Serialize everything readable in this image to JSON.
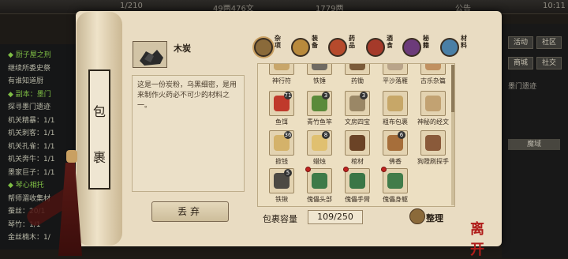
{
  "topbar": {
    "left_text": "1/210",
    "currency": "49两476文",
    "other": "1779两",
    "notice": "公告",
    "clock": "10:11"
  },
  "quest_panel": {
    "lines": [
      {
        "text": "◆ 厨子屋之刑",
        "head": true
      },
      {
        "text": "继续所委史祭",
        "head": false
      },
      {
        "text": "有谁知道厨",
        "head": false
      },
      {
        "text": "◆ 副本：墨门",
        "head": true
      },
      {
        "text": "探寻墨门遗迹",
        "head": false
      },
      {
        "text": "机关精暴：1/1",
        "head": false
      },
      {
        "text": "机关刺客：1/1",
        "head": false
      },
      {
        "text": "机关孔雀：1/1",
        "head": false
      },
      {
        "text": "机关奔牛：1/1",
        "head": false
      },
      {
        "text": "墨家巨子：1/1",
        "head": false
      },
      {
        "text": "◆ 琴心相托",
        "head": true
      },
      {
        "text": "帮师湄收集材",
        "head": false
      },
      {
        "text": "蚕丝：20/1",
        "head": false
      },
      {
        "text": "琴竹：1/1",
        "head": false
      },
      {
        "text": "金丝楠木：1/",
        "head": false
      }
    ]
  },
  "right_panel": {
    "buttons": [
      "活动",
      "社区",
      "商城",
      "社交"
    ],
    "label": "墨门遗迹",
    "inventory_label": "魔域"
  },
  "bag": {
    "title_chars": [
      "包",
      "裹"
    ],
    "selected_item": {
      "name": "木炭",
      "description": "这是一份炭粉，乌黑细密，是用来制作火药必不可少的材料之一。"
    },
    "discard_label": "丢弃",
    "tabs": [
      {
        "label": "杂项",
        "color": "#8a6a3a",
        "active": true
      },
      {
        "label": "装备",
        "color": "#b98a3c",
        "active": false
      },
      {
        "label": "药品",
        "color": "#b64a2c",
        "active": false
      },
      {
        "label": "酒食",
        "color": "#a53a2a",
        "active": false
      },
      {
        "label": "秘籍",
        "color": "#6c3b7a",
        "active": false
      },
      {
        "label": "材料",
        "color": "#4a7fa6",
        "active": false
      }
    ],
    "items": [
      {
        "name": "神行符",
        "color": "#c8a66a",
        "qty": "",
        "rare": false
      },
      {
        "name": "铁锤",
        "color": "#6f6a62",
        "qty": "",
        "rare": false
      },
      {
        "name": "药锄",
        "color": "#7b5b3a",
        "qty": "",
        "rare": false
      },
      {
        "name": "平沙落雁",
        "color": "#b9a48a",
        "qty": "",
        "rare": false
      },
      {
        "name": "古乐杂篇",
        "color": "#c09060",
        "qty": "",
        "rare": false
      },
      {
        "name": "鱼饵",
        "color": "#c0392b",
        "qty": "71",
        "rare": false
      },
      {
        "name": "青竹鱼竿",
        "color": "#5a8a3a",
        "qty": "3",
        "rare": false
      },
      {
        "name": "文房四宝",
        "color": "#9a8766",
        "qty": "3",
        "rare": false
      },
      {
        "name": "粗布包裹",
        "color": "#c7a768",
        "qty": "",
        "rare": false
      },
      {
        "name": "神秘的经文",
        "color": "#c2a272",
        "qty": "",
        "rare": false
      },
      {
        "name": "掀钱",
        "color": "#d4b26a",
        "qty": "36",
        "rare": false
      },
      {
        "name": "蜡烛",
        "color": "#e0c070",
        "qty": "8",
        "rare": false
      },
      {
        "name": "棺材",
        "color": "#6b4326",
        "qty": "",
        "rare": false
      },
      {
        "name": "佛香",
        "color": "#a66e3a",
        "qty": "6",
        "rare": false
      },
      {
        "name": "狗蹬刷探手",
        "color": "#8a5a3a",
        "qty": "",
        "rare": false
      },
      {
        "name": "铁锹",
        "color": "#4d4a44",
        "qty": "5",
        "rare": false
      },
      {
        "name": "傀儡头部",
        "color": "#3e7a48",
        "qty": "",
        "rare": true
      },
      {
        "name": "傀儡手臂",
        "color": "#3a7646",
        "qty": "",
        "rare": true
      },
      {
        "name": "傀儡身躯",
        "color": "#417c4a",
        "qty": "",
        "rare": true
      }
    ],
    "capacity_label": "包裹容量",
    "capacity_value": "109/250",
    "sort_label": "整理"
  },
  "logo_text": "离开"
}
